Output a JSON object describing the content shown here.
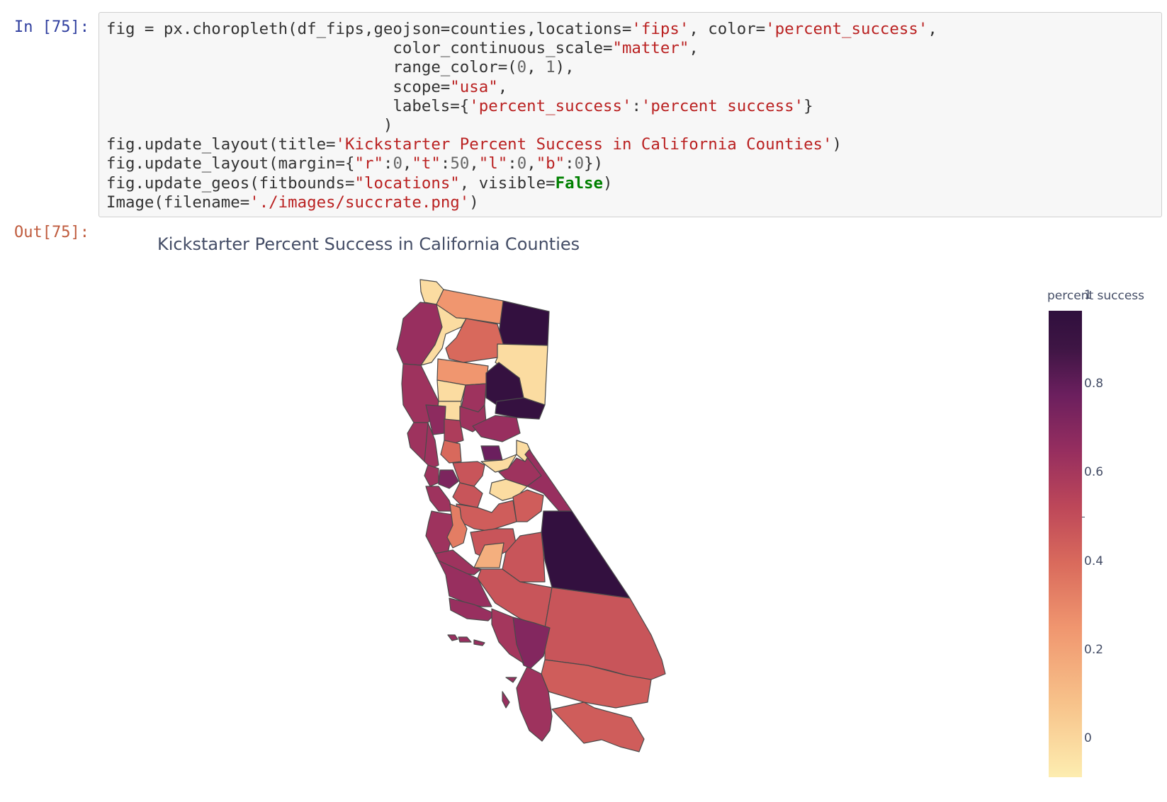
{
  "cell": {
    "in_prompt": "In [75]:",
    "out_prompt": "Out[75]:",
    "code_lines": [
      [
        [
          "fig = px.choropleth(df_fips,geojson=counties,locations=",
          "op"
        ],
        [
          "'fips'",
          "str"
        ],
        [
          ", color=",
          "op"
        ],
        [
          "'percent_success'",
          "str"
        ],
        [
          ",",
          "op"
        ]
      ],
      [
        [
          "                              color_continuous_scale=",
          "op"
        ],
        [
          "\"matter\"",
          "str"
        ],
        [
          ",",
          "op"
        ]
      ],
      [
        [
          "                              range_color=(",
          "op"
        ],
        [
          "0",
          "num"
        ],
        [
          ", ",
          "op"
        ],
        [
          "1",
          "num"
        ],
        [
          "),",
          "op"
        ]
      ],
      [
        [
          "                              scope=",
          "op"
        ],
        [
          "\"usa\"",
          "str"
        ],
        [
          ",",
          "op"
        ]
      ],
      [
        [
          "                              labels={",
          "op"
        ],
        [
          "'percent_success'",
          "str"
        ],
        [
          ":",
          "op"
        ],
        [
          "'percent success'",
          "str"
        ],
        [
          "}",
          "op"
        ]
      ],
      [
        [
          "                             )",
          "op"
        ]
      ],
      [
        [
          "fig.update_layout(title=",
          "op"
        ],
        [
          "'Kickstarter Percent Success in California Counties'",
          "str"
        ],
        [
          ")",
          "op"
        ]
      ],
      [
        [
          "fig.update_layout(margin={",
          "op"
        ],
        [
          "\"r\"",
          "str"
        ],
        [
          ":",
          "op"
        ],
        [
          "0",
          "num"
        ],
        [
          ",",
          "op"
        ],
        [
          "\"t\"",
          "str"
        ],
        [
          ":",
          "op"
        ],
        [
          "50",
          "num"
        ],
        [
          ",",
          "op"
        ],
        [
          "\"l\"",
          "str"
        ],
        [
          ":",
          "op"
        ],
        [
          "0",
          "num"
        ],
        [
          ",",
          "op"
        ],
        [
          "\"b\"",
          "str"
        ],
        [
          ":",
          "op"
        ],
        [
          "0",
          "num"
        ],
        [
          "})",
          "op"
        ]
      ],
      [
        [
          "fig.update_geos(fitbounds=",
          "op"
        ],
        [
          "\"locations\"",
          "str"
        ],
        [
          ", visible=",
          "op"
        ],
        [
          "False",
          "kw"
        ],
        [
          ")",
          "op"
        ]
      ],
      [
        [
          "Image(filename=",
          "op"
        ],
        [
          "'./images/succrate.png'",
          "str"
        ],
        [
          ")",
          "op"
        ]
      ]
    ]
  },
  "figure": {
    "title": "Kickstarter Percent Success in California Counties",
    "colorbar_title": "percent success",
    "colorbar_ticks": [
      "1",
      "0.8",
      "0.6",
      "0.4",
      "0.2",
      "0"
    ],
    "colorscale": "matter",
    "range_color": [
      0,
      1
    ]
  },
  "chart_data": {
    "type": "choropleth",
    "title": "Kickstarter Percent Success in California Counties",
    "scope": "usa",
    "region": "California counties",
    "color_variable": "percent success",
    "range": [
      0,
      1
    ],
    "colorscale_stops": [
      "#fdedb0",
      "#f7c28a",
      "#f0966f",
      "#d96a5c",
      "#bd4759",
      "#962e5f",
      "#6b1f5e",
      "#3e1544",
      "#2f0f3d"
    ],
    "regions": [
      {
        "id": "north-coast-a",
        "value": 0.05
      },
      {
        "id": "north-interior-a",
        "value": 0.25
      },
      {
        "id": "north-east-a",
        "value": 0.97
      },
      {
        "id": "north-coast-b",
        "value": 0.62
      },
      {
        "id": "north-interior-b",
        "value": 0.05
      },
      {
        "id": "north-interior-c",
        "value": 0.38
      },
      {
        "id": "north-east-b",
        "value": 0.05
      },
      {
        "id": "north-valley-a",
        "value": 0.25
      },
      {
        "id": "north-valley-b",
        "value": 0.05
      },
      {
        "id": "sierra-north-a",
        "value": 0.6
      },
      {
        "id": "sierra-north-b",
        "value": 0.95
      },
      {
        "id": "coast-mid-a",
        "value": 0.6
      },
      {
        "id": "valley-mid-a",
        "value": 0.05
      },
      {
        "id": "valley-mid-b",
        "value": 0.6
      },
      {
        "id": "sierra-mid-a",
        "value": 0.95
      },
      {
        "id": "coast-mid-b",
        "value": 0.6
      },
      {
        "id": "valley-mid-c",
        "value": 0.65
      },
      {
        "id": "valley-mid-d",
        "value": 0.55
      },
      {
        "id": "sierra-mid-b",
        "value": 0.62
      },
      {
        "id": "sierra-mid-c",
        "value": 0.05
      },
      {
        "id": "bay-a",
        "value": 0.6
      },
      {
        "id": "bay-b",
        "value": 0.38
      },
      {
        "id": "bay-c",
        "value": 0.75
      },
      {
        "id": "valley-c-a",
        "value": 0.45
      },
      {
        "id": "valley-c-b",
        "value": 0.05
      },
      {
        "id": "sierra-c-a",
        "value": 0.6
      },
      {
        "id": "east-long-a",
        "value": 0.62
      },
      {
        "id": "bay-d",
        "value": 0.6
      },
      {
        "id": "bay-e",
        "value": 0.7
      },
      {
        "id": "valley-c-c",
        "value": 0.45
      },
      {
        "id": "sierra-c-b",
        "value": 0.05
      },
      {
        "id": "bay-f",
        "value": 0.6
      },
      {
        "id": "valley-c-d",
        "value": 0.42
      },
      {
        "id": "sierra-c-c",
        "value": 0.42
      },
      {
        "id": "coast-c-a",
        "value": 0.6
      },
      {
        "id": "coast-c-b",
        "value": 0.32
      },
      {
        "id": "valley-s-a",
        "value": 0.45
      },
      {
        "id": "east-big",
        "value": 0.97
      },
      {
        "id": "valley-s-b",
        "value": 0.18
      },
      {
        "id": "valley-s-c",
        "value": 0.45
      },
      {
        "id": "coast-s-a",
        "value": 0.6
      },
      {
        "id": "valley-s-d",
        "value": 0.45
      },
      {
        "id": "desert-big",
        "value": 0.45
      },
      {
        "id": "coast-s-b",
        "value": 0.62
      },
      {
        "id": "coast-s-c",
        "value": 0.62
      },
      {
        "id": "la-a",
        "value": 0.68
      },
      {
        "id": "la-b",
        "value": 0.58
      },
      {
        "id": "inland-s-a",
        "value": 0.42
      },
      {
        "id": "sd-a",
        "value": 0.6
      },
      {
        "id": "sd-b",
        "value": 0.42
      },
      {
        "id": "island-1",
        "value": 0.62
      },
      {
        "id": "island-2",
        "value": 0.62
      },
      {
        "id": "island-3",
        "value": 0.62
      },
      {
        "id": "island-4",
        "value": 0.62
      },
      {
        "id": "island-5",
        "value": 0.62
      }
    ]
  }
}
